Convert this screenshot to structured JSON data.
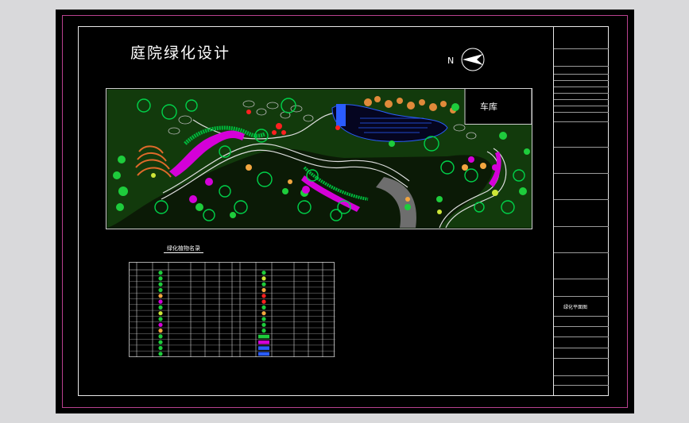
{
  "drawing": {
    "title": "庭院绿化设计",
    "north_label": "N",
    "garage_label": "车库",
    "legend_title": "绿化植物名录",
    "drawing_name": "绿化平面图"
  },
  "colors": {
    "background": "#000000",
    "frame_border": "#b8418f",
    "inner_border": "#e8e8e8",
    "lawn": "#2f6b1a",
    "plant_green": "#00d24a",
    "shrub_magenta": "#d400d8",
    "flower_red": "#ff2020",
    "stone_orange": "#e08a3a",
    "water_blue": "#2a5cff"
  }
}
